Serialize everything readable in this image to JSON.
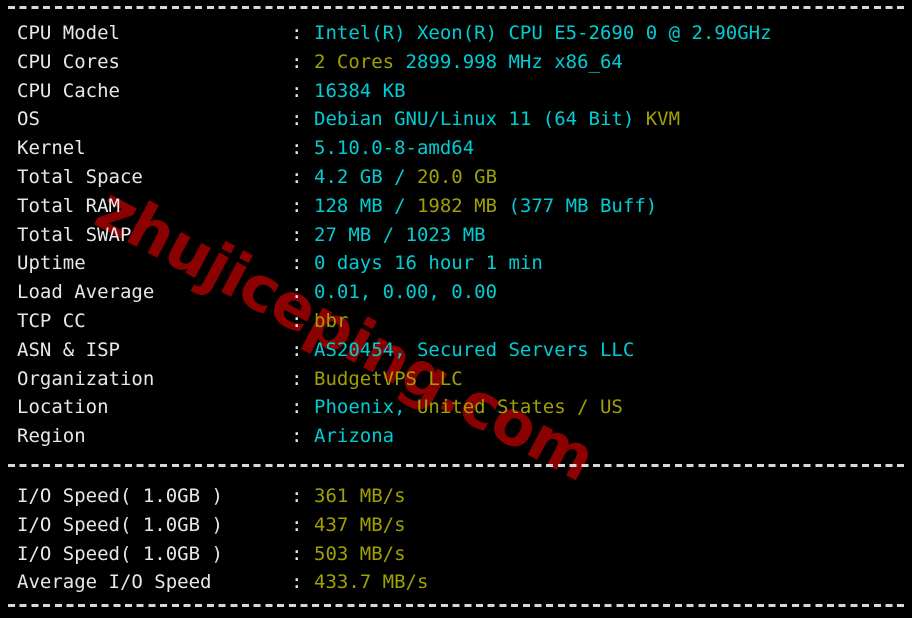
{
  "terminal": {
    "title": "VPS benchmark output",
    "watermark": "zhujiceping.com",
    "colors": {
      "background": "#000000",
      "label": "#e8e8e8",
      "cyan": "#00cdd3",
      "yellow": "#a0a000",
      "watermark": "#8b0000",
      "separator": "#d8d8d8"
    },
    "separators": {
      "top": "------------------------------------------------------------",
      "middle": "------------------------------------------------------------",
      "bottom": "------------------------------------------------------------"
    },
    "system_info": [
      {
        "label": "CPU Model",
        "separator": ":",
        "segments": [
          {
            "text": "Intel(R) Xeon(R) CPU E5-2690 0 @ 2.90GHz",
            "color": "cyan"
          }
        ]
      },
      {
        "label": "CPU Cores",
        "separator": ":",
        "segments": [
          {
            "text": "2 Cores",
            "color": "yellow"
          },
          {
            "text": " 2899.998 MHz x86_64",
            "color": "cyan"
          }
        ]
      },
      {
        "label": "CPU Cache",
        "separator": ":",
        "segments": [
          {
            "text": "16384 KB",
            "color": "cyan"
          }
        ]
      },
      {
        "label": "OS",
        "separator": ":",
        "segments": [
          {
            "text": "Debian GNU/Linux 11 (64 Bit) ",
            "color": "cyan"
          },
          {
            "text": "KVM",
            "color": "yellow"
          }
        ]
      },
      {
        "label": "Kernel",
        "separator": ":",
        "segments": [
          {
            "text": "5.10.0-8-amd64",
            "color": "cyan"
          }
        ]
      },
      {
        "label": "Total Space",
        "separator": ":",
        "segments": [
          {
            "text": "4.2 GB ",
            "color": "cyan"
          },
          {
            "text": "/",
            "color": "cyan"
          },
          {
            "text": " 20.0 GB",
            "color": "yellow"
          }
        ]
      },
      {
        "label": "Total RAM",
        "separator": ":",
        "segments": [
          {
            "text": "128 MB ",
            "color": "cyan"
          },
          {
            "text": "/",
            "color": "cyan"
          },
          {
            "text": " 1982 MB",
            "color": "yellow"
          },
          {
            "text": " (377 MB Buff)",
            "color": "cyan"
          }
        ]
      },
      {
        "label": "Total SWAP",
        "separator": ":",
        "segments": [
          {
            "text": "27 MB / 1023 MB",
            "color": "cyan"
          }
        ]
      },
      {
        "label": "Uptime",
        "separator": ":",
        "segments": [
          {
            "text": "0 days 16 hour 1 min",
            "color": "cyan"
          }
        ]
      },
      {
        "label": "Load Average",
        "separator": ":",
        "segments": [
          {
            "text": "0.01, 0.00, 0.00",
            "color": "cyan"
          }
        ]
      },
      {
        "label": "TCP CC",
        "separator": ":",
        "segments": [
          {
            "text": "bbr",
            "color": "yellow"
          }
        ]
      },
      {
        "label": "ASN & ISP",
        "separator": ":",
        "segments": [
          {
            "text": "AS20454, Secured Servers LLC",
            "color": "cyan"
          }
        ]
      },
      {
        "label": "Organization",
        "separator": ":",
        "segments": [
          {
            "text": "BudgetVPS LLC",
            "color": "yellow"
          }
        ]
      },
      {
        "label": "Location",
        "separator": ":",
        "segments": [
          {
            "text": "Phoenix, ",
            "color": "cyan"
          },
          {
            "text": "United States / US",
            "color": "yellow"
          }
        ]
      },
      {
        "label": "Region",
        "separator": ":",
        "segments": [
          {
            "text": "Arizona",
            "color": "cyan"
          }
        ]
      }
    ],
    "io_results": [
      {
        "label": "I/O Speed( 1.0GB )",
        "separator": ":",
        "segments": [
          {
            "text": "361 MB/s",
            "color": "yellow"
          }
        ]
      },
      {
        "label": "I/O Speed( 1.0GB )",
        "separator": ":",
        "segments": [
          {
            "text": "437 MB/s",
            "color": "yellow"
          }
        ]
      },
      {
        "label": "I/O Speed( 1.0GB )",
        "separator": ":",
        "segments": [
          {
            "text": "503 MB/s",
            "color": "yellow"
          }
        ]
      },
      {
        "label": "Average I/O Speed",
        "separator": ":",
        "segments": [
          {
            "text": "433.7 MB/s",
            "color": "yellow"
          }
        ]
      }
    ]
  }
}
